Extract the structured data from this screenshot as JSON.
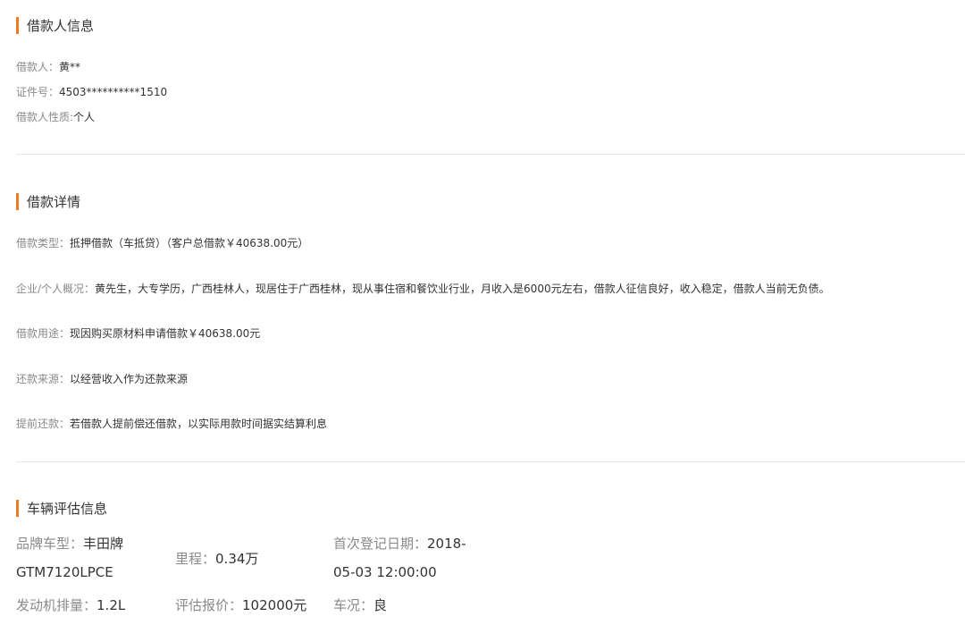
{
  "borrower": {
    "title": "借款人信息",
    "name_label": "借款人：",
    "name_value": "黄**",
    "id_label": "证件号：",
    "id_value": "4503**********1510",
    "nature_label": "借款人性质:",
    "nature_value": "个人"
  },
  "loan": {
    "title": "借款详情",
    "type_label": "借款类型：",
    "type_value": "抵押借款（车抵贷）（客户总借款￥40638.00元）",
    "profile_label": "企业/个人概况：",
    "profile_value": "黄先生，大专学历，广西桂林人，现居住于广西桂林，现从事住宿和餐饮业行业，月收入是6000元左右，借款人征信良好，收入稳定，借款人当前无负债。",
    "purpose_label": "借款用途：",
    "purpose_value": "现因购买原材料申请借款￥40638.00元",
    "repay_label": "还款来源：",
    "repay_value": "以经营收入作为还款来源",
    "early_label": "提前还款：",
    "early_value": "若借款人提前偿还借款，以实际用款时间据实结算利息"
  },
  "vehicle": {
    "title": "车辆评估信息",
    "brand_label": "品牌车型：",
    "brand_value_1": "丰田牌",
    "brand_value_2": "GTM7120LPCE",
    "mileage_label": "里程：",
    "mileage_value": "0.34万",
    "reg_label": "首次登记日期：",
    "reg_value_1": "2018-",
    "reg_value_2": "05-03 12:00:00",
    "engine_label": "发动机排量：",
    "engine_value": "1.2L",
    "price_label": "评估报价：",
    "price_value": "102000元",
    "condition_label": "车况：",
    "condition_value": "良"
  },
  "colors": {
    "accent": "#f07a22",
    "label": "#8a8a8a",
    "text": "#333333",
    "divider": "#e6e6e6"
  }
}
